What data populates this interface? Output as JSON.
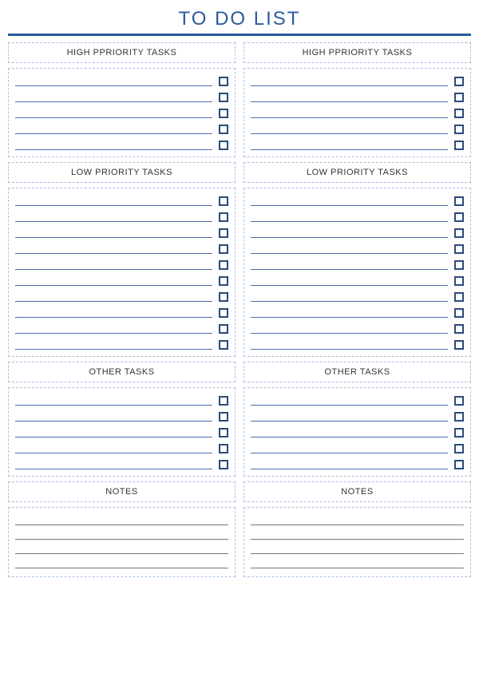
{
  "title": "TO DO LIST",
  "columns": [
    {
      "sections": [
        {
          "header": "HIGH PPRIORITY TASKS",
          "rows": 5,
          "type": "tasks"
        },
        {
          "header": "LOW PRIORITY TASKS",
          "rows": 10,
          "type": "tasks"
        },
        {
          "header": "OTHER TASKS",
          "rows": 5,
          "type": "tasks"
        },
        {
          "header": "NOTES",
          "rows": 4,
          "type": "notes"
        }
      ]
    },
    {
      "sections": [
        {
          "header": "HIGH PPRIORITY TASKS",
          "rows": 5,
          "type": "tasks"
        },
        {
          "header": "LOW PRIORITY TASKS",
          "rows": 10,
          "type": "tasks"
        },
        {
          "header": "OTHER TASKS",
          "rows": 5,
          "type": "tasks"
        },
        {
          "header": "NOTES",
          "rows": 4,
          "type": "notes"
        }
      ]
    }
  ]
}
